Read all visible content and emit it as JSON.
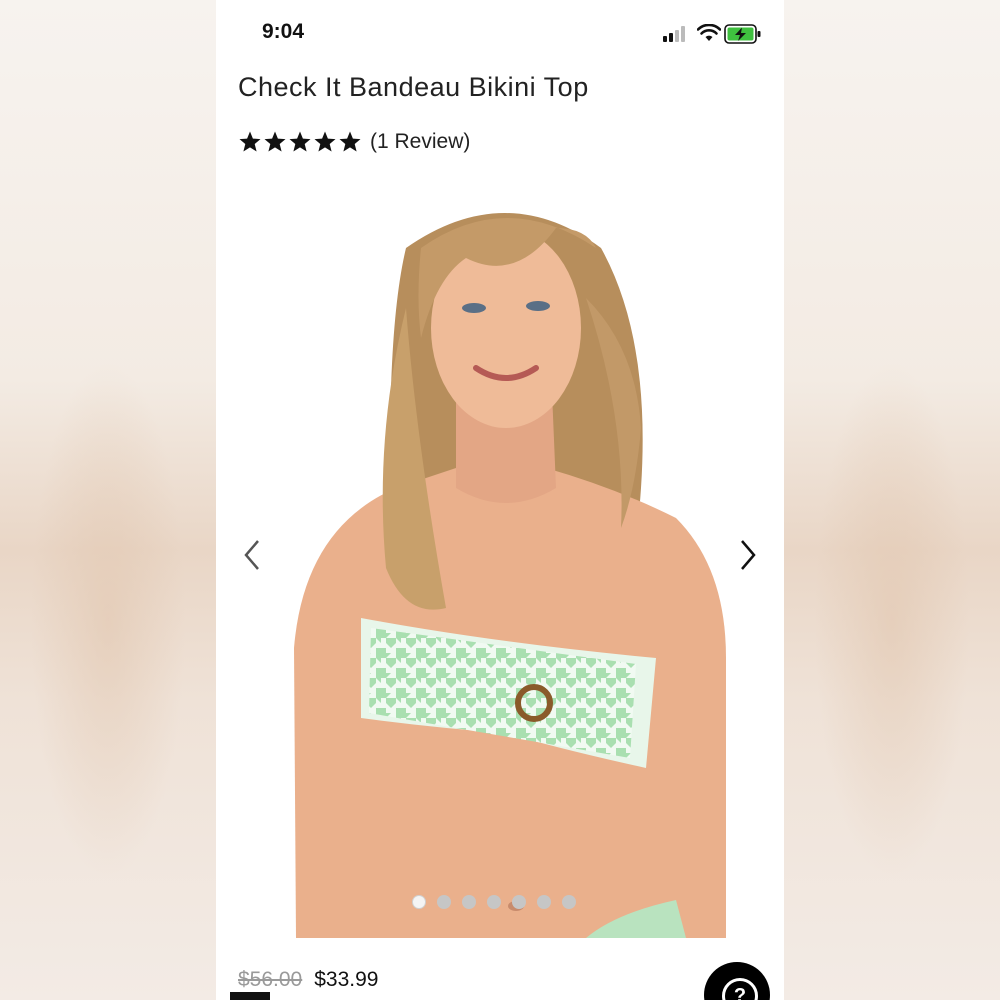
{
  "status_bar": {
    "time": "9:04"
  },
  "product": {
    "title": "Check It Bandeau Bikini Top",
    "rating": 5,
    "review_count_label": "(1 Review)",
    "price_original": "$56.00",
    "price_sale": "$33.99"
  },
  "gallery": {
    "total_images": 7,
    "active_index": 0
  },
  "help": {
    "glyph": "?"
  },
  "colors": {
    "accent": "#000000",
    "bikini_green": "#a9dfb0",
    "battery_green": "#3fc03f"
  }
}
